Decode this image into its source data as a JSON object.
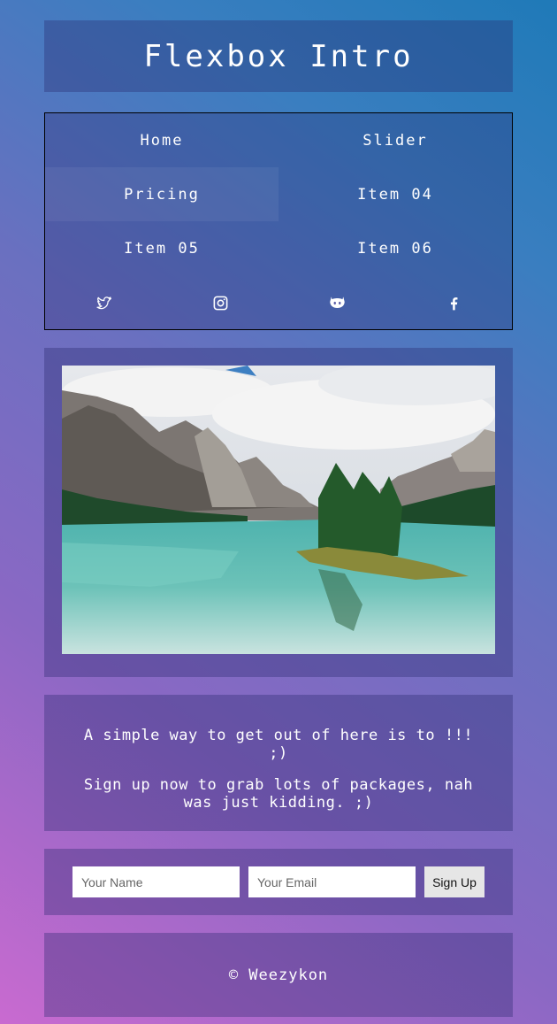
{
  "header": {
    "title": "Flexbox Intro"
  },
  "nav": {
    "items": [
      {
        "label": "Home"
      },
      {
        "label": "Slider"
      },
      {
        "label": "Pricing"
      },
      {
        "label": "Item 04"
      },
      {
        "label": "Item 05"
      },
      {
        "label": "Item 06"
      }
    ],
    "social": [
      "twitter-icon",
      "instagram-icon",
      "github-icon",
      "facebook-icon"
    ]
  },
  "message": {
    "line1": "A simple way to get out of here is to !!! ;)",
    "line2": "Sign up now to grab lots of packages, nah was just kidding. ;)"
  },
  "signup": {
    "name_placeholder": "Your Name",
    "email_placeholder": "Your Email",
    "button_label": "Sign Up"
  },
  "footer": {
    "text": "© Weezykon"
  }
}
